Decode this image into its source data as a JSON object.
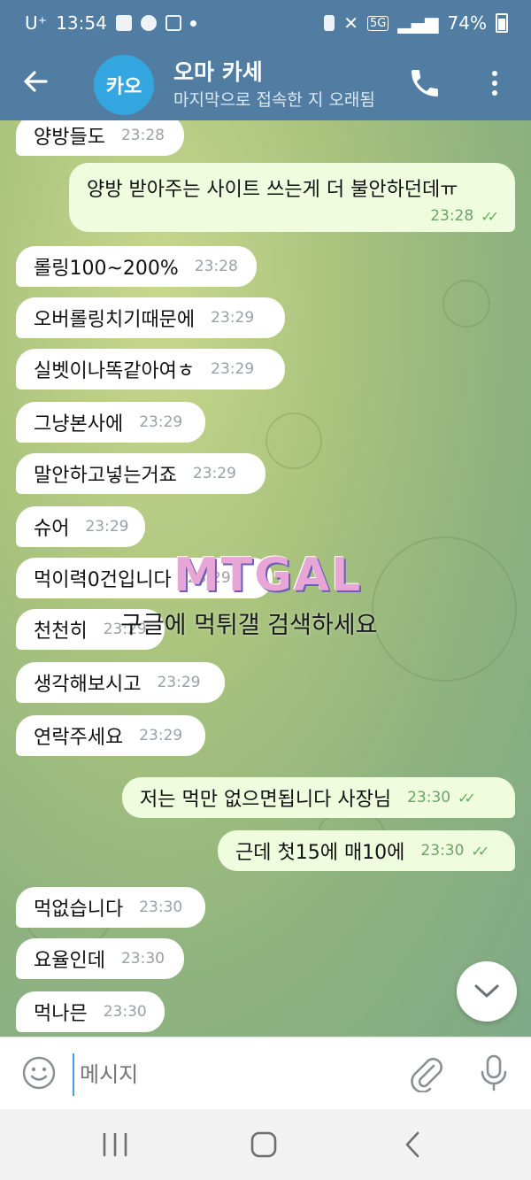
{
  "status_bar": {
    "carrier": "U⁺",
    "time": "13:54",
    "network": "5G",
    "battery": "74%"
  },
  "header": {
    "avatar_text": "카오",
    "title": "오마 카세",
    "subtitle": "마지막으로 접속한 지 오래됨",
    "accent_color": "#517da2"
  },
  "messages": [
    {
      "dir": "in",
      "text": "양방들도",
      "time": "23:28"
    },
    {
      "dir": "out",
      "text": "양방 받아주는 사이트 쓰는게 더 불안하던데ㅠ",
      "time": "23:28"
    },
    {
      "dir": "in",
      "text": "롤링100~200%",
      "time": "23:28"
    },
    {
      "dir": "in",
      "text": "오버롤링치기때문에",
      "time": "23:29"
    },
    {
      "dir": "in",
      "text": "실벳이나똑같아여ㅎ",
      "time": "23:29"
    },
    {
      "dir": "in",
      "text": "그냥본사에",
      "time": "23:29"
    },
    {
      "dir": "in",
      "text": "말안하고넣는거죠",
      "time": "23:29"
    },
    {
      "dir": "in",
      "text": "슈어",
      "time": "23:29"
    },
    {
      "dir": "in",
      "text": "먹이력0건입니다",
      "time": "23:29"
    },
    {
      "dir": "in",
      "text": "천천히",
      "time": "23:29"
    },
    {
      "dir": "in",
      "text": "생각해보시고",
      "time": "23:29"
    },
    {
      "dir": "in",
      "text": "연락주세요",
      "time": "23:29"
    },
    {
      "dir": "out",
      "text": "저는 먹만 없으면됩니다 사장님",
      "time": "23:30"
    },
    {
      "dir": "out",
      "text": "근데 첫15에 매10에",
      "time": "23:30"
    },
    {
      "dir": "in",
      "text": "먹없습니다",
      "time": "23:30"
    },
    {
      "dir": "in",
      "text": "요율인데",
      "time": "23:30"
    },
    {
      "dir": "in",
      "text": "먹나믄",
      "time": "23:30"
    }
  ],
  "watermark": {
    "logo": "MTGAL",
    "text": "구글에 먹튀갤 검색하세요"
  },
  "composer": {
    "placeholder": "메시지"
  },
  "icons": {
    "back": "arrow-left-icon",
    "call": "phone-icon",
    "menu": "more-vertical-icon",
    "emoji": "emoji-icon",
    "attach": "paperclip-icon",
    "mic": "microphone-icon",
    "scroll": "chevron-down-icon"
  }
}
